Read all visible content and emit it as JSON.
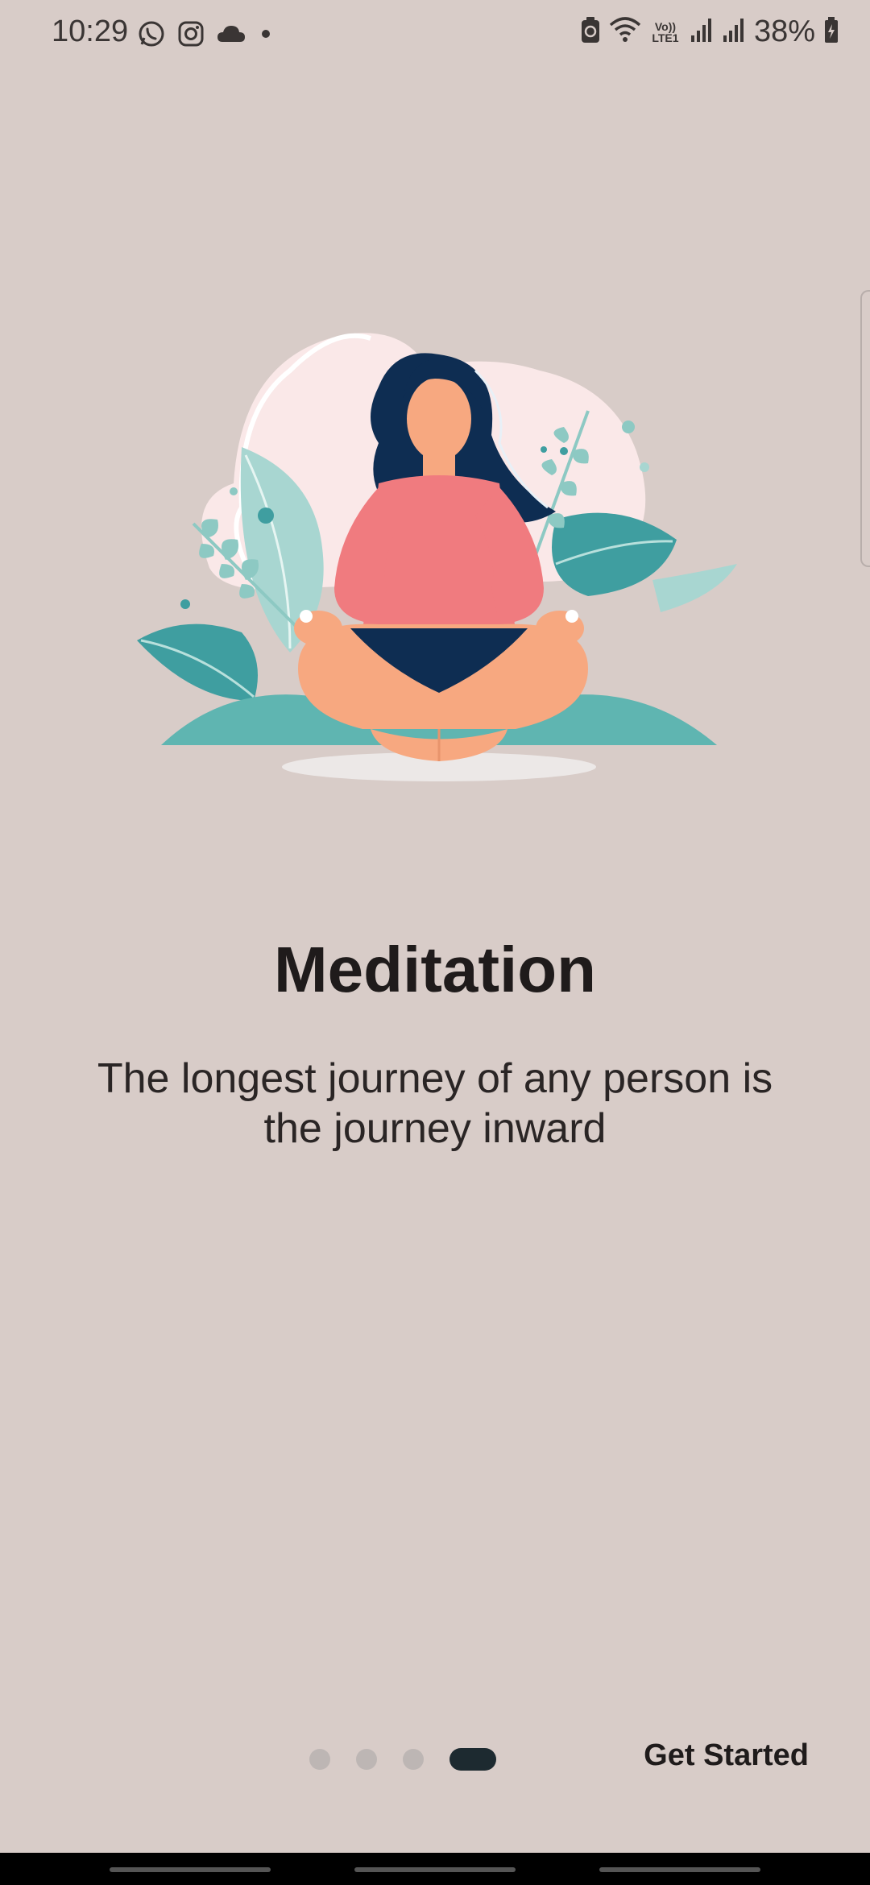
{
  "status_bar": {
    "time": "10:29",
    "battery": "38%",
    "lte_top": "Vo))",
    "lte_bottom": "LTE1",
    "icons": [
      "whatsapp-icon",
      "instagram-icon",
      "cloud-icon",
      "dot-icon",
      "battery-saver-icon",
      "wifi-icon",
      "signal-icon",
      "signal-icon",
      "battery-icon"
    ]
  },
  "onboarding": {
    "illustration": "meditation-woman-illustration",
    "title": "Meditation",
    "description": "The longest journey of any person is the journey inward"
  },
  "pager": {
    "page_count": 4,
    "current_page": 4
  },
  "actions": {
    "get_started": "Get Started"
  },
  "colors": {
    "background": "#d8ccc8",
    "text": "#1f1b1b",
    "pager_active": "#1d2a30",
    "pager_inactive": "#bdb6b4",
    "shirt": "#f07b7f",
    "pants": "#0e2d52",
    "skin": "#f7a880",
    "leaves": "#5fb5b1"
  }
}
